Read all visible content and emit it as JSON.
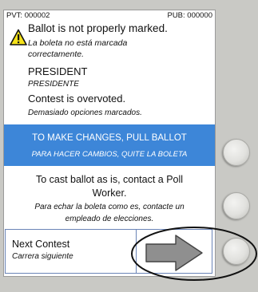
{
  "counters": {
    "pvt": "PVT: 000002",
    "pub": "PUB: 000000"
  },
  "warning": {
    "icon": "warning-triangle-icon",
    "title_en": "Ballot is not properly marked.",
    "title_es_line1": "La boleta no está marcada",
    "title_es_line2": "correctamente."
  },
  "contest": {
    "name_en": "PRESIDENT",
    "name_es": "PRESIDENTE"
  },
  "status": {
    "en": "Contest is overvoted.",
    "es": "Demasiado opciones marcados."
  },
  "banner": {
    "en": "TO MAKE CHANGES, PULL BALLOT",
    "es": "PARA HACER CAMBIOS, QUITE LA BOLETA",
    "color": "#3d86d8"
  },
  "cast_info": {
    "en_line1": "To cast ballot as is, contact a Poll",
    "en_line2": "Worker.",
    "es_line1": "Para echar la boleta como es,  contacte un",
    "es_line2": "empleado de elecciones."
  },
  "next_contest": {
    "en": "Next Contest",
    "es": "Carrera siguiente",
    "icon": "arrow-right-icon"
  },
  "hardware_buttons": [
    "side-button-top",
    "side-button-middle",
    "side-button-bottom"
  ]
}
